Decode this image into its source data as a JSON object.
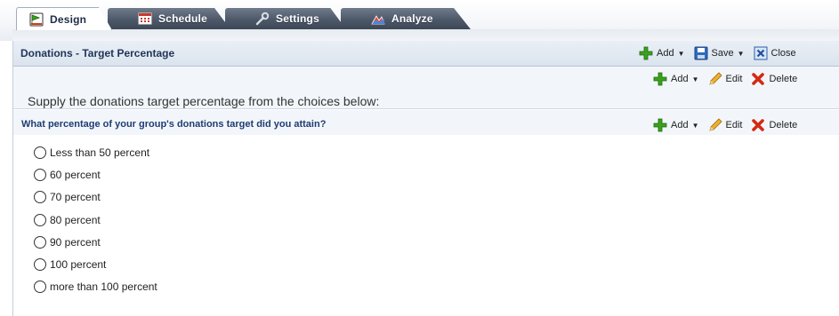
{
  "tabs": [
    {
      "label": "Design",
      "icon": "design-icon",
      "active": true
    },
    {
      "label": "Schedule",
      "icon": "schedule-icon",
      "active": false
    },
    {
      "label": "Settings",
      "icon": "wrench-icon",
      "active": false
    },
    {
      "label": "Analyze",
      "icon": "analyze-icon",
      "active": false
    }
  ],
  "header": {
    "title": "Donations - Target Percentage",
    "add_label": "Add",
    "save_label": "Save",
    "close_label": "Close"
  },
  "section": {
    "add_label": "Add",
    "edit_label": "Edit",
    "delete_label": "Delete",
    "instructions": "Supply the donations target percentage from the choices below:"
  },
  "question": {
    "text": "What percentage of your group's donations target did you attain?",
    "add_label": "Add",
    "edit_label": "Edit",
    "delete_label": "Delete",
    "choices": [
      "Less than 50 percent",
      "60 percent",
      "70 percent",
      "80 percent",
      "90 percent",
      "100 percent",
      "more than 100 percent"
    ]
  },
  "colors": {
    "accent": "#23355a",
    "add_green": "#3aa21e",
    "delete_red": "#d42a12",
    "save_blue": "#2f6bbf"
  }
}
